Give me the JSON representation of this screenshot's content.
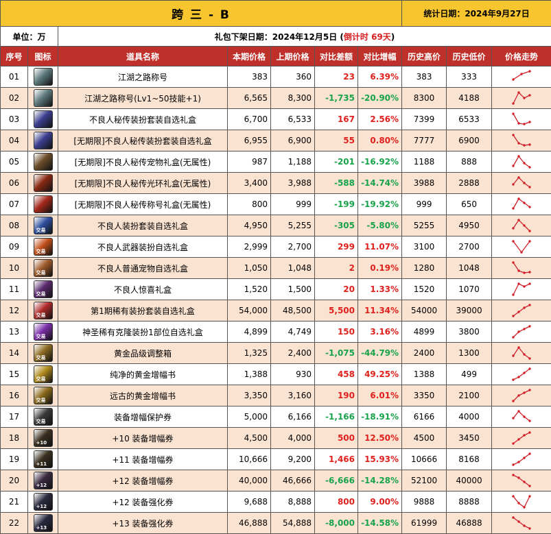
{
  "header": {
    "title": "跨 三 - B",
    "stat_date": "统计日期：2024年9月27日",
    "unit": "单位：万",
    "release_prefix": "礼包下架日期：2024年12月5日 (",
    "release_countdown": "倒计时 69天",
    "release_suffix": ")"
  },
  "columns": [
    "序号",
    "图标",
    "道具名称",
    "本期价格",
    "上期价格",
    "对比差额",
    "对比增幅",
    "历史高价",
    "历史低价",
    "价格走势"
  ],
  "rows": [
    {
      "no": "01",
      "name": "江湖之路称号",
      "cur": "383",
      "prev": "360",
      "diff": "23",
      "pct": "6.39%",
      "high": "383",
      "low": "333",
      "icon": "title-badge-icon",
      "color": "#5d7a7d",
      "tag": "",
      "trend": [
        0.3,
        0.7,
        0.9
      ]
    },
    {
      "no": "02",
      "name": "江湖之路称号(Lv1~50技能+1)",
      "cur": "6,565",
      "prev": "8,300",
      "diff": "-1,735",
      "pct": "-20.90%",
      "high": "8300",
      "low": "4188",
      "icon": "title-badge-icon",
      "color": "#5d7a7d",
      "tag": "",
      "trend": [
        0.1,
        0.9,
        0.5,
        0.7
      ]
    },
    {
      "no": "03",
      "name": "不良人秘传装扮套装自选礼盒",
      "cur": "6,700",
      "prev": "6,533",
      "diff": "167",
      "pct": "2.56%",
      "high": "7399",
      "low": "6533",
      "icon": "avatar-box-icon",
      "color": "#3b3f8f",
      "tag": "",
      "trend": [
        0.9,
        0.2,
        0.15,
        0.3
      ]
    },
    {
      "no": "04",
      "name": "[无期限]不良人秘传装扮套装自选礼盒",
      "cur": "6,955",
      "prev": "6,900",
      "diff": "55",
      "pct": "0.80%",
      "high": "7777",
      "low": "6900",
      "icon": "avatar-box-icon",
      "color": "#3b3f8f",
      "tag": "",
      "trend": [
        0.9,
        0.3,
        0.15,
        0.2
      ]
    },
    {
      "no": "05",
      "name": "[无期限]不良人秘传宠物礼盒(无属性)",
      "cur": "987",
      "prev": "1,188",
      "diff": "-201",
      "pct": "-16.92%",
      "high": "1188",
      "low": "888",
      "icon": "pet-box-icon",
      "color": "#6b4d2a",
      "tag": "",
      "trend": [
        0.2,
        0.9,
        0.4,
        0.1
      ]
    },
    {
      "no": "06",
      "name": "[无期限]不良人秘传光环礼盒(无属性)",
      "cur": "3,400",
      "prev": "3,988",
      "diff": "-588",
      "pct": "-14.74%",
      "high": "3988",
      "low": "2888",
      "icon": "aura-box-icon",
      "color": "#8a2a12",
      "tag": "",
      "trend": [
        0.4,
        0.9,
        0.5,
        0.2
      ]
    },
    {
      "no": "07",
      "name": "[无期限]不良人秘传称号礼盒(无属性)",
      "cur": "800",
      "prev": "999",
      "diff": "-199",
      "pct": "-19.92%",
      "high": "999",
      "low": "650",
      "icon": "title-box-icon",
      "color": "#a5281c",
      "tag": "",
      "trend": [
        0.2,
        0.9,
        0.6,
        0.3
      ]
    },
    {
      "no": "08",
      "name": "不良人装扮套装自选礼盒",
      "cur": "4,950",
      "prev": "5,255",
      "diff": "-305",
      "pct": "-5.80%",
      "high": "5255",
      "low": "4950",
      "icon": "avatar-box-icon",
      "color": "#2f4f9e",
      "tag": "交易",
      "trend": [
        0.3,
        0.9,
        0.5,
        0.1
      ]
    },
    {
      "no": "09",
      "name": "不良人武器装扮自选礼盒",
      "cur": "2,999",
      "prev": "2,700",
      "diff": "299",
      "pct": "11.07%",
      "high": "3100",
      "low": "2700",
      "icon": "weapon-box-icon",
      "color": "#c4501c",
      "tag": "交易",
      "trend": [
        0.9,
        0.1,
        0.9
      ]
    },
    {
      "no": "10",
      "name": "不良人普通宠物自选礼盒",
      "cur": "1,050",
      "prev": "1,048",
      "diff": "2",
      "pct": "0.19%",
      "high": "1280",
      "low": "1048",
      "icon": "pet-box-icon",
      "color": "#9e5a2a",
      "tag": "交易",
      "trend": [
        0.9,
        0.3,
        0.15,
        0.2
      ]
    },
    {
      "no": "11",
      "name": "不良人惊喜礼盒",
      "cur": "1,520",
      "prev": "1,500",
      "diff": "20",
      "pct": "1.33%",
      "high": "1520",
      "low": "1070",
      "icon": "surprise-box-icon",
      "color": "#5a2a6e",
      "tag": "交易",
      "trend": [
        0.1,
        0.9,
        0.7,
        0.9
      ]
    },
    {
      "no": "12",
      "name": "第1期稀有装扮套装自选礼盒",
      "cur": "54,000",
      "prev": "48,500",
      "diff": "5,500",
      "pct": "11.34%",
      "high": "54000",
      "low": "39000",
      "icon": "rare-avatar-box-icon",
      "color": "#b02a2a",
      "tag": "交易",
      "trend": [
        0.1,
        0.4,
        0.7,
        0.9
      ]
    },
    {
      "no": "13",
      "name": "神圣稀有克隆装扮1部位自选礼盒",
      "cur": "4,899",
      "prev": "4,749",
      "diff": "150",
      "pct": "3.16%",
      "high": "4899",
      "low": "3800",
      "icon": "clone-avatar-box-icon",
      "color": "#7b2fa8",
      "tag": "交易",
      "trend": [
        0.1,
        0.5,
        0.7,
        0.9
      ]
    },
    {
      "no": "14",
      "name": "黄金品级调整箱",
      "cur": "1,325",
      "prev": "2,400",
      "diff": "-1,075",
      "pct": "-44.79%",
      "high": "2400",
      "low": "1300",
      "icon": "grade-box-icon",
      "color": "#8c6a22",
      "tag": "交易",
      "trend": [
        0.3,
        0.9,
        0.4,
        0.1
      ]
    },
    {
      "no": "15",
      "name": "纯净的黄金增幅书",
      "cur": "1,388",
      "prev": "930",
      "diff": "458",
      "pct": "49.25%",
      "high": "1388",
      "low": "499",
      "icon": "amplify-book-icon",
      "color": "#b08a1c",
      "tag": "交易",
      "trend": [
        0.1,
        0.3,
        0.6,
        0.9
      ]
    },
    {
      "no": "16",
      "name": "远古的黄金增幅书",
      "cur": "3,350",
      "prev": "3,160",
      "diff": "190",
      "pct": "6.01%",
      "high": "3350",
      "low": "2100",
      "icon": "amplify-book-icon",
      "color": "#8c6a1c",
      "tag": "交易",
      "trend": [
        0.1,
        0.5,
        0.7,
        0.9
      ]
    },
    {
      "no": "17",
      "name": "装备增幅保护券",
      "cur": "5,000",
      "prev": "6,166",
      "diff": "-1,166",
      "pct": "-18.91%",
      "high": "6166",
      "low": "4000",
      "icon": "protect-ticket-icon",
      "color": "#3a3a3a",
      "tag": "交易",
      "trend": [
        0.4,
        0.9,
        0.5,
        0.2
      ]
    },
    {
      "no": "18",
      "name": "+10 装备增幅券",
      "cur": "4,500",
      "prev": "4,000",
      "diff": "500",
      "pct": "12.50%",
      "high": "4500",
      "low": "3450",
      "icon": "amplify-ticket-10-icon",
      "color": "#3a3020",
      "tag": "+10",
      "trend": [
        0.1,
        0.4,
        0.7,
        0.9
      ]
    },
    {
      "no": "19",
      "name": "+11 装备增幅券",
      "cur": "10,666",
      "prev": "9,200",
      "diff": "1,466",
      "pct": "15.93%",
      "high": "10666",
      "low": "8168",
      "icon": "amplify-ticket-11-icon",
      "color": "#3a3020",
      "tag": "+11",
      "trend": [
        0.1,
        0.3,
        0.6,
        0.9
      ]
    },
    {
      "no": "20",
      "name": "+12 装备增幅券",
      "cur": "40,000",
      "prev": "46,666",
      "diff": "-6,666",
      "pct": "-14.28%",
      "high": "52100",
      "low": "40000",
      "icon": "amplify-ticket-12-icon",
      "color": "#3a2a40",
      "tag": "+12",
      "trend": [
        0.9,
        0.7,
        0.4,
        0.1
      ]
    },
    {
      "no": "21",
      "name": "+12 装备强化券",
      "cur": "9,688",
      "prev": "8,888",
      "diff": "800",
      "pct": "9.00%",
      "high": "9888",
      "low": "8888",
      "icon": "reinforce-ticket-12-icon",
      "color": "#2a2a40",
      "tag": "+12",
      "trend": [
        0.9,
        0.4,
        0.1,
        0.9
      ]
    },
    {
      "no": "22",
      "name": "+13 装备强化券",
      "cur": "46,888",
      "prev": "54,888",
      "diff": "-8,000",
      "pct": "-14.58%",
      "high": "61999",
      "low": "46888",
      "icon": "reinforce-ticket-13-icon",
      "color": "#2a2a40",
      "tag": "+13",
      "trend": [
        0.9,
        0.6,
        0.3,
        0.1
      ]
    }
  ]
}
